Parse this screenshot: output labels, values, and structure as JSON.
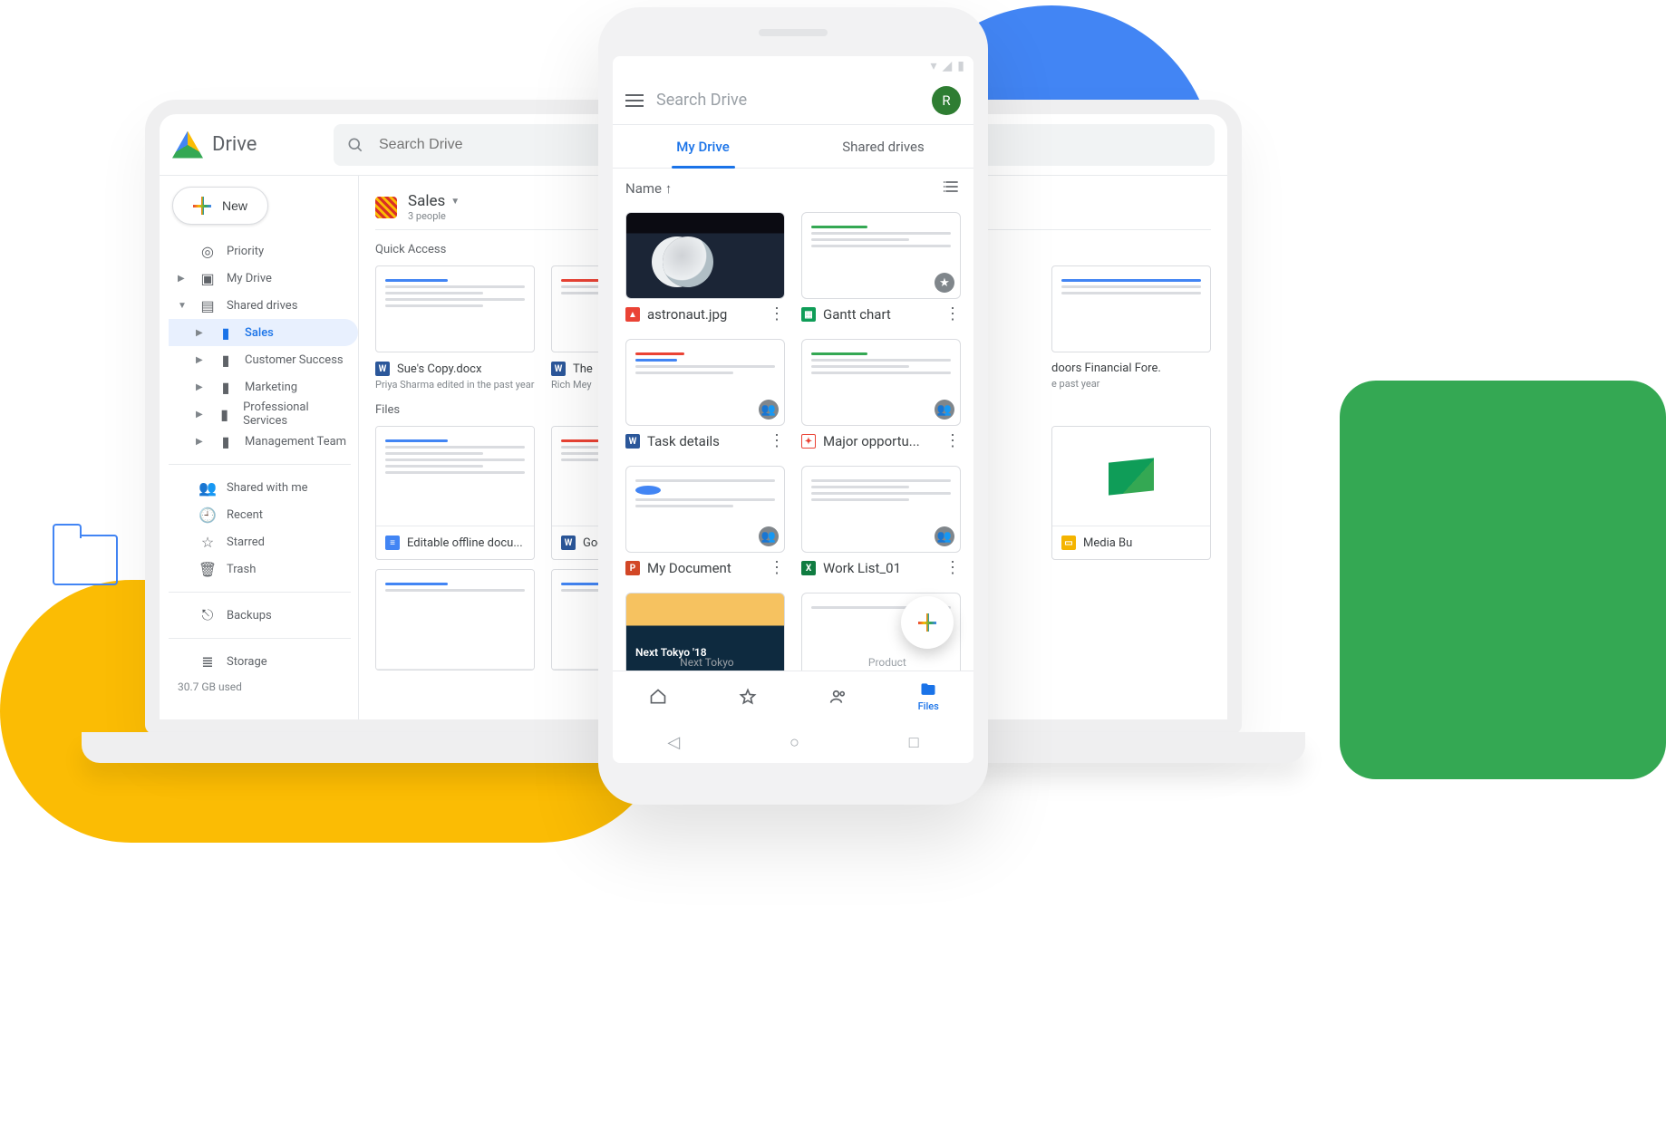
{
  "colors": {
    "blue": "#1a73e8",
    "green": "#34a853",
    "yellow": "#fbbc04",
    "red": "#ea4335"
  },
  "desktop": {
    "app_title": "Drive",
    "search_placeholder": "Search Drive",
    "new_button": "New",
    "nav": {
      "priority": "Priority",
      "my_drive": "My Drive",
      "shared_drives": "Shared drives",
      "drives": [
        {
          "label": "Sales",
          "active": true
        },
        {
          "label": "Customer Success"
        },
        {
          "label": "Marketing"
        },
        {
          "label": "Professional Services"
        },
        {
          "label": "Management Team"
        }
      ],
      "shared_with_me": "Shared with me",
      "recent": "Recent",
      "starred": "Starred",
      "trash": "Trash",
      "backups": "Backups",
      "storage": "Storage",
      "storage_used": "30.7 GB used"
    },
    "context": {
      "title": "Sales",
      "subtitle": "3 people"
    },
    "sections": {
      "quick_access": "Quick Access",
      "files": "Files"
    },
    "quick_access": [
      {
        "icon": "word",
        "label": "Sue's Copy.docx",
        "sub": "Priya Sharma edited in the past year"
      },
      {
        "icon": "word",
        "label": "The",
        "sub": "Rich Mey"
      },
      {
        "icon": "sheet",
        "label": "doors Financial Fore.",
        "sub": "e past year"
      }
    ],
    "files_row1": [
      {
        "icon": "doc",
        "label": "Editable offline docu..."
      },
      {
        "icon": "word",
        "label": "Google"
      },
      {
        "icon": "slide",
        "label": "Media Bu"
      }
    ],
    "files_row2": [
      {
        "icon": "doc",
        "label": ""
      },
      {
        "icon": "doc",
        "label": ""
      }
    ]
  },
  "mobile": {
    "search_placeholder": "Search Drive",
    "avatar_initial": "R",
    "tabs": {
      "my_drive": "My Drive",
      "shared_drives": "Shared drives"
    },
    "sort": {
      "label": "Name",
      "dir": "↑"
    },
    "files": [
      {
        "icon": "img",
        "label": "astronaut.jpg",
        "thumb": "astro"
      },
      {
        "icon": "sheet",
        "label": "Gantt chart",
        "badge": "star"
      },
      {
        "icon": "word",
        "label": "Task details",
        "badge": "shared"
      },
      {
        "icon": "pdf",
        "label": "Major opportu...",
        "badge": "shared"
      },
      {
        "icon": "ppt",
        "label": "My Document",
        "badge": "shared"
      },
      {
        "icon": "xls",
        "label": "Work List_01",
        "badge": "shared"
      },
      {
        "icon": "slide",
        "label": "",
        "thumb": "tokyo"
      },
      {
        "icon": "doc",
        "label": ""
      }
    ],
    "hidden_row": {
      "left": "Next Tokyo",
      "right": "Product"
    },
    "bottom_nav": {
      "home": "Home",
      "starred": "Starred",
      "shared": "Shared",
      "files": "Files"
    }
  }
}
